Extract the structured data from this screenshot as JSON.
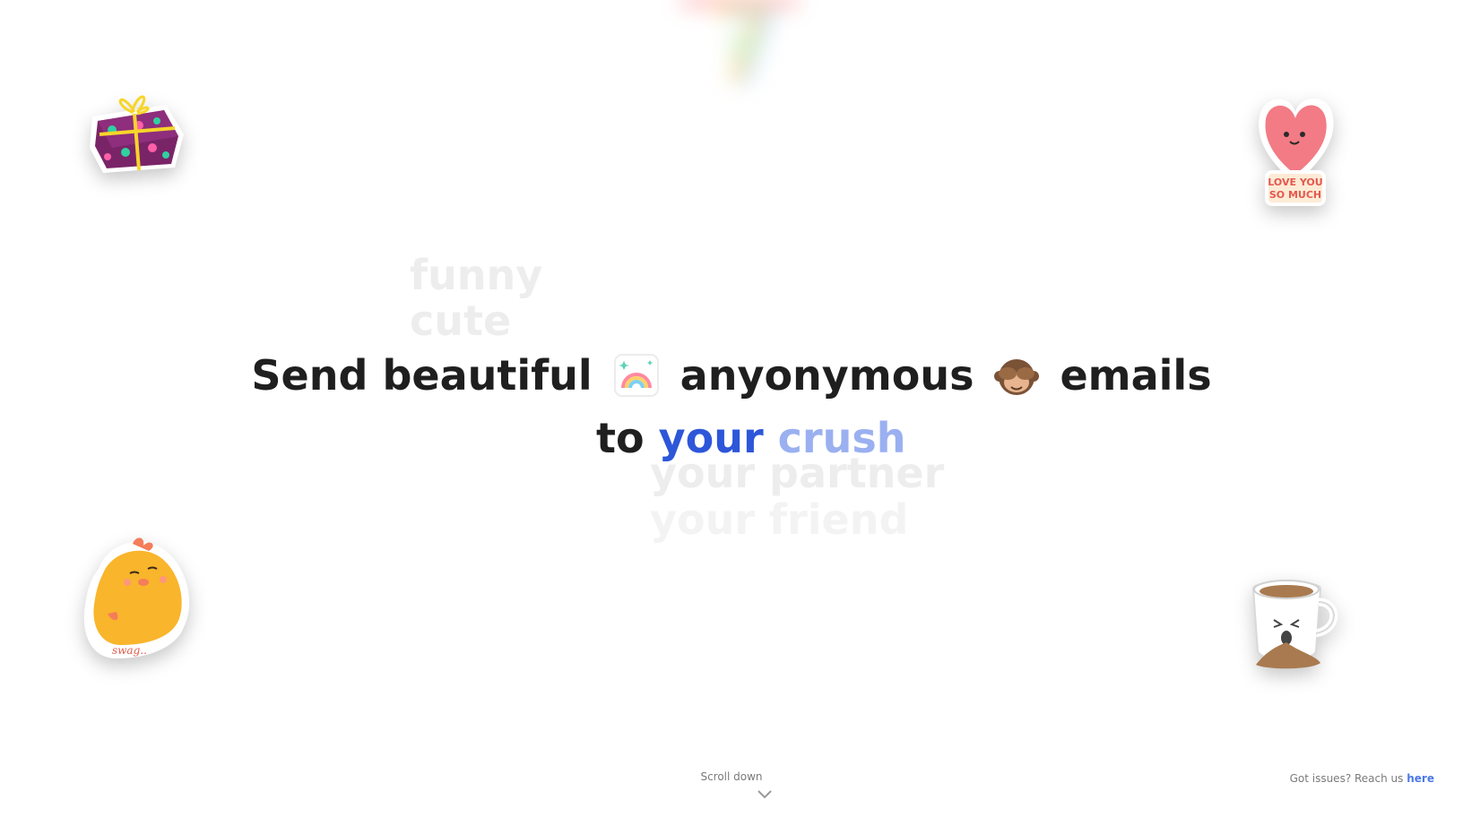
{
  "headline": {
    "prefix": "Send beautiful",
    "middle": "anyonymous",
    "suffix": "emails",
    "to": "to",
    "accent_word1": "your",
    "accent_word2": "crush"
  },
  "rotating_above": [
    "funny",
    "cute"
  ],
  "rotating_below": [
    "your partner",
    "your friend"
  ],
  "scroll": {
    "label": "Scroll down"
  },
  "footer": {
    "text": "Got issues? Reach us",
    "link_label": "here"
  },
  "colors": {
    "text": "#1f1f1f",
    "accent": "#2d56d9",
    "accent_light": "#9ab0f0",
    "ghost": "#ededed",
    "link": "#4b79e6"
  },
  "icons": [
    "rainbow-emoji-icon",
    "see-no-evil-monkey-emoji-icon",
    "gift-sticker",
    "heart-love-you-sticker",
    "chick-swag-sticker",
    "coffee-cup-sticker",
    "chevron-down-icon"
  ]
}
